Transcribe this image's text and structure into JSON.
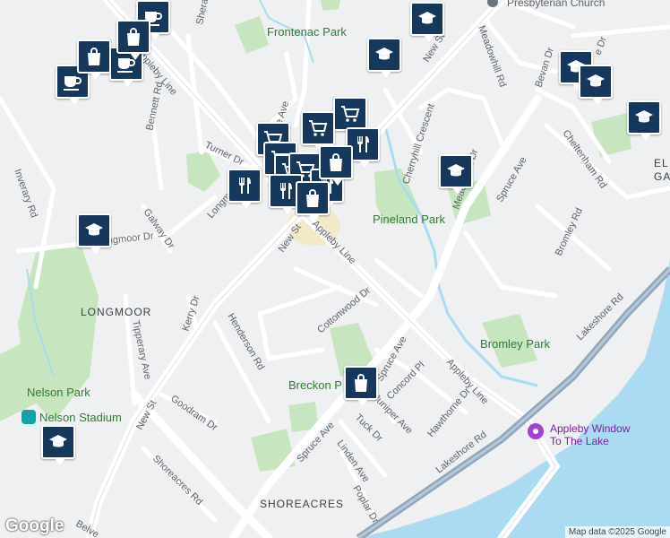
{
  "map": {
    "areas": {
      "longmoor": "LONGMOOR",
      "shoreacres": "SHOREACRES",
      "el_ga_partial": [
        "EL",
        "GA"
      ]
    },
    "parks": {
      "frontenac": "Frontenac Park",
      "pineland": "Pineland Park",
      "bromley": "Bromley Park",
      "breckon": "Breckon P",
      "nelson": "Nelson Park",
      "nelson_stadium": "Nelson Stadium"
    },
    "pois": {
      "appleby_window_line1": "Appleby Window",
      "appleby_window_line2": "To The Lake",
      "church": "Presbyterian Church"
    },
    "roads": {
      "new_st_top": "New St",
      "new_st_mid": "New St",
      "new_st_low": "New St",
      "appleby_line_top": "Appleby Line",
      "appleby_line_mid": "Appleby Line",
      "appleby_line_low": "Appleby Line",
      "lakeshore_1": "Lakeshore Rd",
      "lakeshore_2": "Lakeshore Rd",
      "spruce_ave_1": "Spruce Ave",
      "spruce_ave_2": "Spruce Ave",
      "spruce_ave_3": "Spruce Ave",
      "meadowhill_rd": "Meadowhill Rd",
      "meadowhill_dr": "Meadowhill Dr",
      "cherryhill": "Cherryhill Crescent",
      "sheraton": "Sheraton Rd",
      "bennett": "Bennett Rd",
      "turner": "Turner Dr",
      "longmoor_dr_1": "Longmoor Dr",
      "longmoor_dr_2": "Longmoor Dr",
      "galway": "Galway Dr",
      "inverary": "Inverary Rd",
      "tipperary": "Tipperary Ave",
      "kerry": "Kerry Dr",
      "henderson": "Henderson Rd",
      "goodram": "Goodram Dr",
      "shoreacres_rd": "Shoreacres Rd",
      "cottonwood": "Cottonwood Dr",
      "concord": "Concord Pl",
      "juniper": "Juniper Ave",
      "hawthorne": "Hawthorne Dr",
      "tuck": "Tuck Dr",
      "linden": "Linden Ave",
      "poplar": "Poplar Dr",
      "bevan": "Bevan Dr",
      "cheltenham": "Cheltenham Rd",
      "bromley_rd": "Bromley Rd",
      "belvenia_partial": "Belve",
      "ave_partial": "e Ave",
      "dr_partial": "e Dr"
    },
    "markers": [
      {
        "type": "cafe",
        "icon": "coffee-cup-icon"
      },
      {
        "type": "cafe",
        "icon": "coffee-cup-icon"
      },
      {
        "type": "cafe",
        "icon": "coffee-cup-icon"
      },
      {
        "type": "shopping",
        "icon": "shopping-bag-icon"
      },
      {
        "type": "shopping",
        "icon": "shopping-bag-icon"
      },
      {
        "type": "school",
        "icon": "graduation-cap-icon"
      },
      {
        "type": "school",
        "icon": "graduation-cap-icon"
      },
      {
        "type": "school",
        "icon": "graduation-cap-icon"
      },
      {
        "type": "school",
        "icon": "graduation-cap-icon"
      },
      {
        "type": "school",
        "icon": "graduation-cap-icon"
      },
      {
        "type": "school",
        "icon": "graduation-cap-icon"
      },
      {
        "type": "school",
        "icon": "graduation-cap-icon"
      },
      {
        "type": "school",
        "icon": "graduation-cap-icon"
      },
      {
        "type": "grocery",
        "icon": "shopping-cart-icon"
      },
      {
        "type": "grocery",
        "icon": "shopping-cart-icon"
      },
      {
        "type": "grocery",
        "icon": "shopping-cart-icon"
      },
      {
        "type": "grocery",
        "icon": "shopping-cart-icon"
      },
      {
        "type": "grocery",
        "icon": "shopping-cart-icon"
      },
      {
        "type": "grocery",
        "icon": "shopping-cart-icon"
      },
      {
        "type": "restaurant",
        "icon": "fork-knife-icon"
      },
      {
        "type": "restaurant",
        "icon": "fork-knife-icon"
      },
      {
        "type": "restaurant",
        "icon": "fork-knife-icon"
      },
      {
        "type": "restaurant",
        "icon": "fork-knife-icon"
      },
      {
        "type": "shopping",
        "icon": "shopping-bag-icon"
      },
      {
        "type": "shopping",
        "icon": "shopping-bag-icon"
      },
      {
        "type": "shopping",
        "icon": "shopping-bag-icon"
      }
    ]
  },
  "footer": {
    "logo": "Google",
    "attribution": "Map data ©2025 Google"
  },
  "colors": {
    "water": "#a9dcf0",
    "park": "#c7e6bf",
    "marker": "#16385c",
    "highway": "#8fa6bc",
    "road": "#ffffff"
  }
}
